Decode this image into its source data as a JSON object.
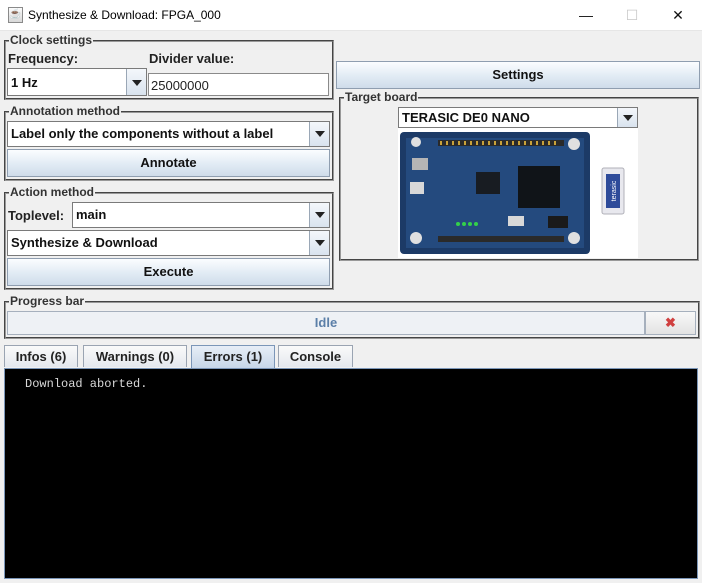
{
  "window": {
    "title": "Synthesize & Download: FPGA_000",
    "minimize": "—",
    "maximize": "☐",
    "close": "✕",
    "app_icon_glyph": "☕"
  },
  "clock": {
    "legend": "Clock settings",
    "frequency_label": "Frequency:",
    "frequency_value": "1 Hz",
    "divider_label": "Divider value:",
    "divider_value": "25000000"
  },
  "annotation": {
    "legend": "Annotation method",
    "method_value": "Label only the components without a label",
    "annotate_button": "Annotate"
  },
  "action": {
    "legend": "Action method",
    "toplevel_label": "Toplevel:",
    "toplevel_value": "main",
    "action_value": "Synthesize & Download",
    "execute_button": "Execute"
  },
  "settings_button": "Settings",
  "target": {
    "legend": "Target board",
    "board_value": "TERASIC  DE0  NANO",
    "board_image_name": "de0-nano-board-image",
    "side_logo_text": "terasic"
  },
  "progress": {
    "legend": "Progress bar",
    "status": "Idle",
    "cancel_glyph": "✖"
  },
  "tabs": [
    {
      "label": "Infos (6)",
      "selected": false
    },
    {
      "label": "Warnings (0)",
      "selected": false
    },
    {
      "label": "Errors (1)",
      "selected": true
    },
    {
      "label": "Console",
      "selected": false
    }
  ],
  "console_lines": [
    "Download aborted."
  ],
  "colors": {
    "console_bg": "#000000",
    "console_text": "#d8d8d8",
    "progress_text": "#5b7fa8",
    "cancel_icon": "#d04040"
  }
}
